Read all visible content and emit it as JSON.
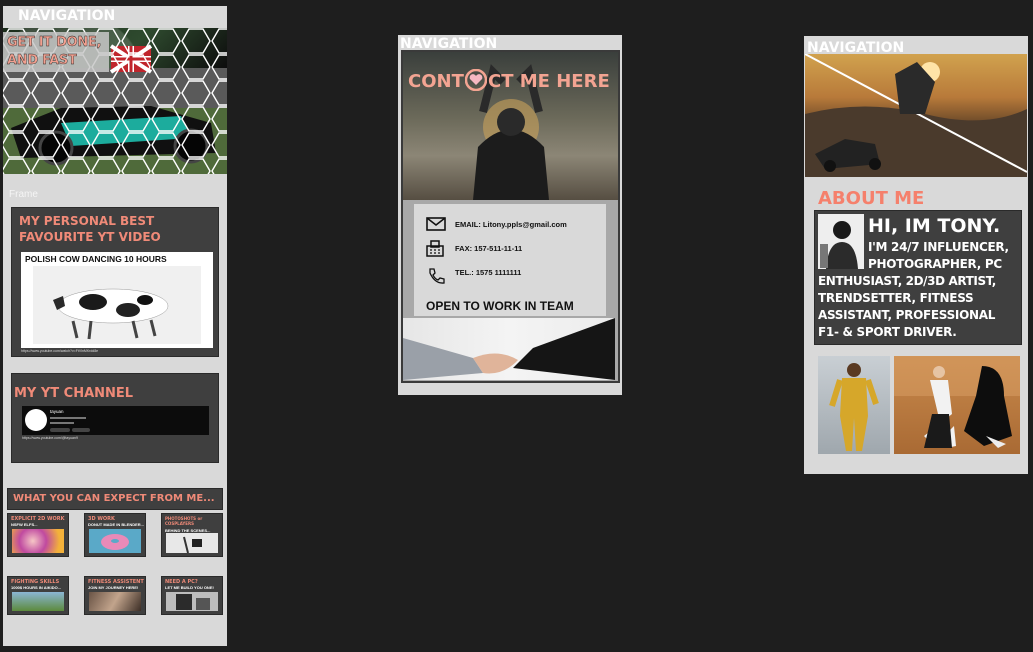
{
  "frame1": {
    "nav": "NAVIGATION",
    "hero_title_line1": "GET IT DONE,",
    "hero_title_line2": "AND FAST",
    "frame_label": "Frame",
    "personal_best": {
      "title_line1": "MY PERSONAL BEST",
      "title_line2": "FAVOURITE YT VIDEO",
      "video_title": "POLISH COW DANCING 10 HOURS",
      "video_link": "https://www.youtube.com/watch?v=FtVlnMKrdd8e"
    },
    "yt_channel": {
      "title": "MY YT CHANNEL",
      "channel_name": "tayuan",
      "channel_link": "https://www.youtube.com/@tayuan9"
    },
    "expect": {
      "title": "WHAT YOU CAN EXPECT FROM ME...",
      "cards": [
        {
          "title": "EXPLICIT 2D WORK",
          "sub": "NSFW ELFS..."
        },
        {
          "title": "3D WORK",
          "sub": "DONUT MADE IN BLENDER..."
        },
        {
          "title": "PHOTOSHOTS or COSPLAYERS",
          "sub": "BEHIND THE SCENES..."
        },
        {
          "title": "FIGHTING SKILLS",
          "sub": "1000$ HOURS IN AIKIDO..."
        },
        {
          "title": "FITNESS ASSISTENT",
          "sub": "JOIN MY JOURNEY HERE!"
        },
        {
          "title": "NEED A PC?",
          "sub": "LET ME BUILD YOU ONE!"
        }
      ]
    }
  },
  "frame2": {
    "nav": "NAVIGATION",
    "contact_title_part1": "CONT",
    "contact_title_part2": "CT ME HERE",
    "email": "EMAIL: Litony.ppls@gmail.com",
    "fax": "FAX: 157-511-11-11",
    "tel": "TEL.: 1575 1111111",
    "open_to_work": "OPEN TO WORK IN TEAM"
  },
  "frame3": {
    "nav": "NAVIGATION",
    "about_title": "ABOUT ME",
    "greeting": "HI, IM TONY.",
    "bio_line1": "I'M 24/7 INFLUENCER,",
    "bio_line2": "PHOTOGRAPHER, PC",
    "bio_line3": "ENTHUSIAST, 2D/3D ARTIST,",
    "bio_line4": "TRENDSETTER, FITNESS",
    "bio_line5": "ASSISTANT, PROFESSIONAL",
    "bio_line6": "F1- & SPORT DRIVER."
  },
  "colors": {
    "canvas_bg": "#1e1e1e",
    "frame_bg": "#d9d9d9",
    "panel_bg": "#3f3f3f",
    "accent": "#f08a78"
  }
}
